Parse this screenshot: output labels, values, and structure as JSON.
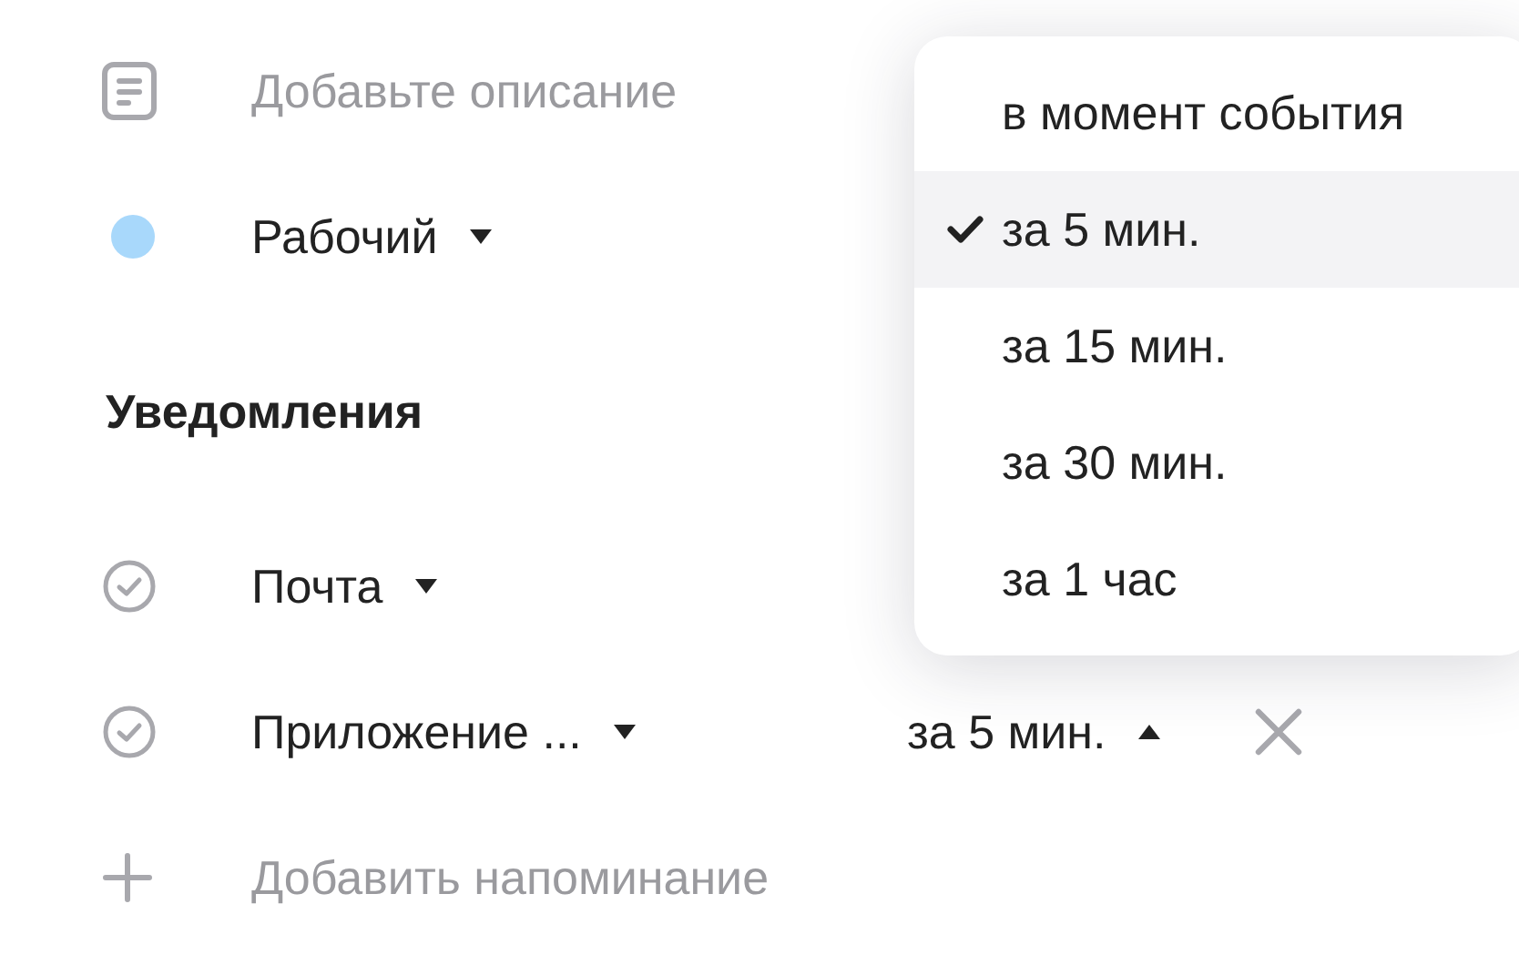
{
  "description": {
    "placeholder": "Добавьте описание"
  },
  "calendar": {
    "name": "Рабочий",
    "color": "#a8d8fb"
  },
  "notifications": {
    "title": "Уведомления",
    "items": [
      {
        "channel": "Почта"
      },
      {
        "channel": "Приложение ...",
        "time": "за 5 мин.",
        "expanded": true
      }
    ]
  },
  "add_button": "Добавить напоминание",
  "time_menu": [
    {
      "label": "в момент события",
      "selected": false
    },
    {
      "label": "за 5 мин.",
      "selected": true
    },
    {
      "label": "за 15 мин.",
      "selected": false
    },
    {
      "label": "за 30 мин.",
      "selected": false
    },
    {
      "label": "за 1 час",
      "selected": false
    }
  ]
}
